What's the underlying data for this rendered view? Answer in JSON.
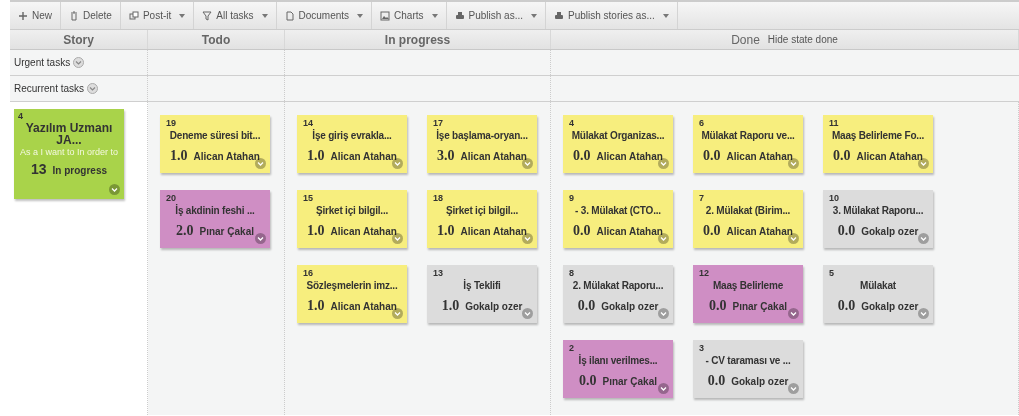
{
  "toolbar": [
    {
      "label": "New",
      "dropdown": false
    },
    {
      "label": "Delete",
      "dropdown": false
    },
    {
      "label": "Post-it",
      "dropdown": true
    },
    {
      "label": "All tasks",
      "dropdown": true
    },
    {
      "label": "Documents",
      "dropdown": true
    },
    {
      "label": "Charts",
      "dropdown": true
    },
    {
      "label": "Publish as...",
      "dropdown": true
    },
    {
      "label": "Publish stories as...",
      "dropdown": true
    }
  ],
  "columns": [
    {
      "title": "Story"
    },
    {
      "title": "Todo"
    },
    {
      "title": "In progress"
    },
    {
      "title": "Done",
      "link": "Hide state done"
    }
  ],
  "swimlanes": [
    {
      "label": "Urgent tasks"
    },
    {
      "label": "Recurrent tasks"
    }
  ],
  "story": {
    "number": "4",
    "title": "Yazılım Uzmanı JA...",
    "description": "As a I want to In order to",
    "points": "13",
    "state": "In progress",
    "color": "#a9d34a"
  },
  "lanes": [
    {
      "cards": [
        {
          "number": "19",
          "title": "Deneme süresi bit...",
          "points": "1.0",
          "owner": "Alican Atahan",
          "color": "#f7ee7e"
        },
        {
          "number": "20",
          "title": "İş akdinin feshi ...",
          "points": "2.0",
          "owner": "Pınar Çakal",
          "color": "#cf8ec4"
        }
      ]
    },
    {
      "cards": [
        {
          "number": "14",
          "title": "İşe giriş evrakla...",
          "points": "1.0",
          "owner": "Alican Atahan",
          "color": "#f7ee7e"
        },
        {
          "number": "17",
          "title": "İşe başlama-oryan...",
          "points": "3.0",
          "owner": "Alican Atahan",
          "color": "#f7ee7e"
        },
        {
          "number": "15",
          "title": "Şirket içi bilgil...",
          "points": "1.0",
          "owner": "Alican Atahan",
          "color": "#f7ee7e"
        },
        {
          "number": "18",
          "title": "Şirket içi bilgil...",
          "points": "1.0",
          "owner": "Alican Atahan",
          "color": "#f7ee7e"
        },
        {
          "number": "16",
          "title": "Sözleşmelerin imz...",
          "points": "1.0",
          "owner": "Alican Atahan",
          "color": "#f7ee7e"
        },
        {
          "number": "13",
          "title": "İş Teklifi",
          "points": "1.0",
          "owner": "Gokalp ozer",
          "color": "#dcdcdc"
        }
      ]
    },
    {
      "cards": [
        {
          "number": "4",
          "title": "Mülakat Organizas...",
          "points": "0.0",
          "owner": "Alican Atahan",
          "color": "#f7ee7e"
        },
        {
          "number": "6",
          "title": "Mülakat Raporu ve...",
          "points": "0.0",
          "owner": "Alican Atahan",
          "color": "#f7ee7e"
        },
        {
          "number": "11",
          "title": "Maaş Belirleme Fo...",
          "points": "0.0",
          "owner": "Alican Atahan",
          "color": "#f7ee7e"
        },
        {
          "number": "9",
          "title": "- 3. Mülakat (CTO...",
          "points": "0.0",
          "owner": "Alican Atahan",
          "color": "#f7ee7e"
        },
        {
          "number": "7",
          "title": "2. Mülakat (Birim...",
          "points": "0.0",
          "owner": "Alican Atahan",
          "color": "#f7ee7e"
        },
        {
          "number": "10",
          "title": "3. Mülakat Raporu...",
          "points": "0.0",
          "owner": "Gokalp ozer",
          "color": "#dcdcdc"
        },
        {
          "number": "8",
          "title": "2. Mülakat Raporu...",
          "points": "0.0",
          "owner": "Gokalp ozer",
          "color": "#dcdcdc"
        },
        {
          "number": "12",
          "title": "Maaş Belirleme",
          "points": "0.0",
          "owner": "Pınar Çakal",
          "color": "#cf8ec4"
        },
        {
          "number": "5",
          "title": "Mülakat",
          "points": "0.0",
          "owner": "Gokalp ozer",
          "color": "#dcdcdc"
        },
        {
          "number": "2",
          "title": "İş ilanı verilmes...",
          "points": "0.0",
          "owner": "Pınar Çakal",
          "color": "#cf8ec4"
        },
        {
          "number": "3",
          "title": "- CV taraması ve ...",
          "points": "0.0",
          "owner": "Gokalp ozer",
          "color": "#dcdcdc"
        }
      ]
    }
  ]
}
